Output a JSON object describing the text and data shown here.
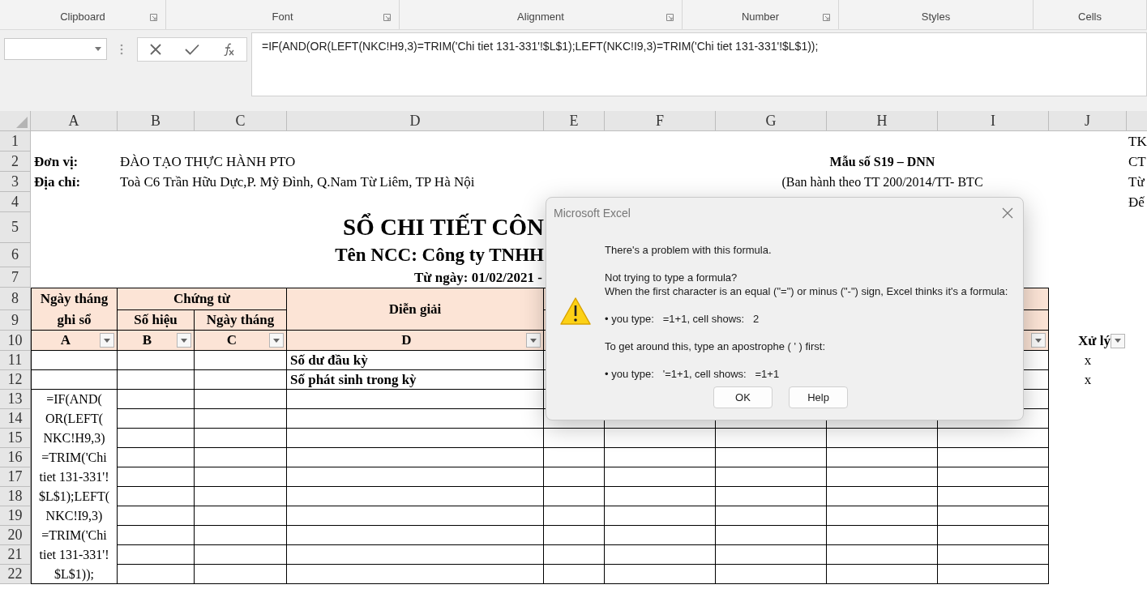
{
  "ribbon_groups": [
    {
      "label": "Clipboard",
      "launcher": true
    },
    {
      "label": "Font",
      "launcher": true
    },
    {
      "label": "Alignment",
      "launcher": true
    },
    {
      "label": "Number",
      "launcher": true
    },
    {
      "label": "Styles",
      "launcher": false
    },
    {
      "label": "Cells",
      "launcher": false
    }
  ],
  "formula_bar": {
    "formula": "=IF(AND(OR(LEFT(NKC!H9,3)=TRIM('Chi tiet 131-331'!$L$1);LEFT(NKC!I9,3)=TRIM('Chi tiet 131-331'!$L$1));"
  },
  "column_headers": [
    "A",
    "B",
    "C",
    "D",
    "E",
    "F",
    "G",
    "H",
    "I",
    "J"
  ],
  "row_headers": [
    "1",
    "2",
    "3",
    "4",
    "5",
    "6",
    "7",
    "8",
    "9",
    "10",
    "11",
    "12",
    "13",
    "14",
    "15",
    "16",
    "17",
    "18",
    "19",
    "20",
    "21",
    "22"
  ],
  "sheet": {
    "unit_label": "Đơn vị:",
    "unit_value": "ĐÀO TẠO THỰC HÀNH PTO",
    "address_label": "Địa chỉ:",
    "address_value": "Toà C6 Trần Hữu Dực,P. Mỹ Đình, Q.Nam Từ Liêm, TP Hà Nội",
    "form_number": "Mẫu số S19 – DNN",
    "form_issued": "(Ban hành theo TT 200/2014/TT- BTC",
    "side_labels": [
      "TK",
      "CT",
      "Từ",
      "Đế"
    ],
    "title": "SỔ CHI TIẾT CÔN",
    "supplier": "Tên NCC: Công ty TNHH",
    "period": "Từ ngày: 01/02/2021 -",
    "table_header": {
      "date": "Ngày tháng ghi sổ",
      "voucher": "Chứng từ",
      "voucher_no": "Số hiệu",
      "voucher_date": "Ngày tháng",
      "description": "Diễn giải"
    },
    "filter_row": [
      {
        "label": "A"
      },
      {
        "label": "B"
      },
      {
        "label": "C"
      },
      {
        "label": "D"
      }
    ],
    "process_header": "Xử lý",
    "rows": [
      {
        "description": "Số dư đầu kỳ",
        "process": "x"
      },
      {
        "description": "Số phát sinh trong kỳ",
        "process": "x"
      }
    ],
    "formula_cell": "=IF(AND(\nOR(LEFT(\nNKC!H9,3)\n=TRIM('Chi\ntiet 131-331'!\n$L$1);LEFT(\nNKC!I9,3)\n=TRIM('Chi\ntiet 131-331'!\n$L$1));"
  },
  "dialog": {
    "title": "Microsoft Excel",
    "paragraphs": [
      [
        "There's a problem with this formula."
      ],
      [
        "Not trying to type a formula?",
        "When the first character is an equal (\"=\") or minus (\"-\") sign, Excel thinks it's a formula:"
      ],
      [
        "• you type:   =1+1, cell shows:   2"
      ],
      [
        "To get around this, type an apostrophe ( ' ) first:"
      ],
      [
        "• you type:   '=1+1, cell shows:   =1+1"
      ]
    ],
    "buttons": [
      "OK",
      "Help"
    ]
  }
}
